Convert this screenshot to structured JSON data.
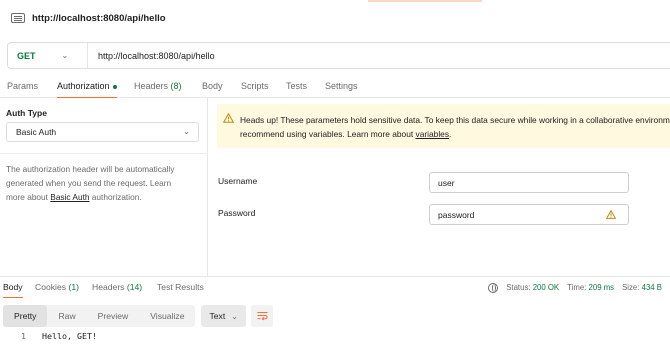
{
  "request": {
    "title": "http://localhost:8080/api/hello",
    "method": "GET",
    "url": "http://localhost:8080/api/hello"
  },
  "request_tabs": {
    "params": "Params",
    "authorization": "Authorization",
    "headers": "Headers",
    "headers_count": "(8)",
    "body": "Body",
    "scripts": "Scripts",
    "tests": "Tests",
    "settings": "Settings"
  },
  "auth": {
    "type_label": "Auth Type",
    "type_value": "Basic Auth",
    "description_1": "The authorization header will be automatically",
    "description_2": "generated when you send the request. Learn",
    "description_3a": "more about ",
    "description_3_link": "Basic Auth",
    "description_3b": " authorization."
  },
  "warning": {
    "line1": "Heads up! These parameters hold sensitive data. To keep this data secure while working in a collaborative environment, we",
    "line2a": "recommend using variables. Learn more about ",
    "line2_link": "variables",
    "line2b": "."
  },
  "fields": {
    "username_label": "Username",
    "username_value": "user",
    "password_label": "Password",
    "password_value": "password"
  },
  "response_tabs": {
    "body": "Body",
    "cookies": "Cookies",
    "cookies_count": "(1)",
    "headers": "Headers",
    "headers_count": "(14)",
    "test_results": "Test Results"
  },
  "status": {
    "status_label": "Status:",
    "status_value": "200 OK",
    "time_label": "Time:",
    "time_value": "209 ms",
    "size_label": "Size:",
    "size_value": "434 B"
  },
  "format": {
    "pretty": "Pretty",
    "raw": "Raw",
    "preview": "Preview",
    "visualize": "Visualize",
    "text_select": "Text"
  },
  "response_body": {
    "line_number": "1",
    "line_text": "Hello, GET!"
  },
  "colors": {
    "accent": "#ff6c37",
    "success_green": "#0b7a3e",
    "warning_bg": "#fff9e0",
    "warning_icon": "#c08a00"
  },
  "icons": {
    "request": "http-request-icon",
    "warning": "warning-triangle-icon",
    "globe": "globe-icon",
    "wrap": "wrap-lines-icon",
    "chevron": "chevron-down-icon"
  }
}
